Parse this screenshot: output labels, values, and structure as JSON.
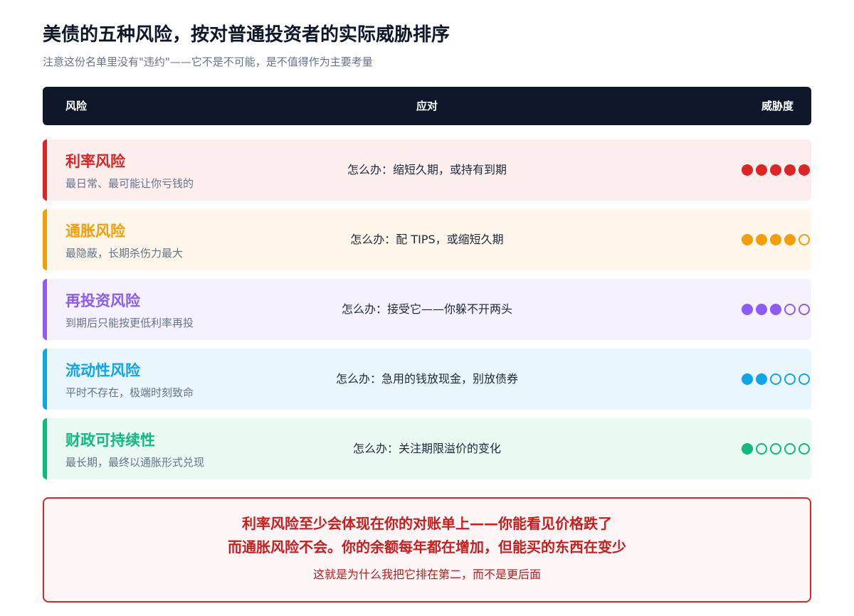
{
  "title": "美债的五种风险，按对普通投资者的实际威胁排序",
  "subtitle": "注意这份名单里没有\"违约\"——它不是不可能，是不值得作为主要考量",
  "header": {
    "risk": "风险",
    "response": "应对",
    "threat": "威胁度"
  },
  "risks": [
    {
      "name": "利率风险",
      "desc": "最日常、最可能让你亏钱的",
      "response": "怎么办：缩短久期，或持有到期",
      "threat": 5,
      "max": 5,
      "color": "#dc2626",
      "bg": "#fdeeee"
    },
    {
      "name": "通胀风险",
      "desc": "最隐蔽，长期杀伤力最大",
      "response": "怎么办：配 TIPS，或缩短久期",
      "threat": 4,
      "max": 5,
      "color": "#f59e0b",
      "bg": "#fef6ea"
    },
    {
      "name": "再投资风险",
      "desc": "到期后只能按更低利率再投",
      "response": "怎么办：接受它——你躲不开两头",
      "threat": 3,
      "max": 5,
      "color": "#8b5cf6",
      "bg": "#f5f1fe"
    },
    {
      "name": "流动性风险",
      "desc": "平时不存在，极端时刻致命",
      "response": "怎么办：急用的钱放现金，别放债券",
      "threat": 2,
      "max": 5,
      "color": "#0ea5e9",
      "bg": "#eaf6fd"
    },
    {
      "name": "财政可持续性",
      "desc": "最长期，最终以通胀形式兑现",
      "response": "怎么办：关注期限溢价的变化",
      "threat": 1,
      "max": 5,
      "color": "#10b981",
      "bg": "#eafaf3"
    }
  ],
  "callout": {
    "line1": "利率风险至少会体现在你的对账单上——你能看见价格跌了",
    "line2": "而通胀风险不会。你的余额每年都在增加，但能买的东西在变少",
    "line3": "这就是为什么我把它排在第二，而不是更后面"
  }
}
